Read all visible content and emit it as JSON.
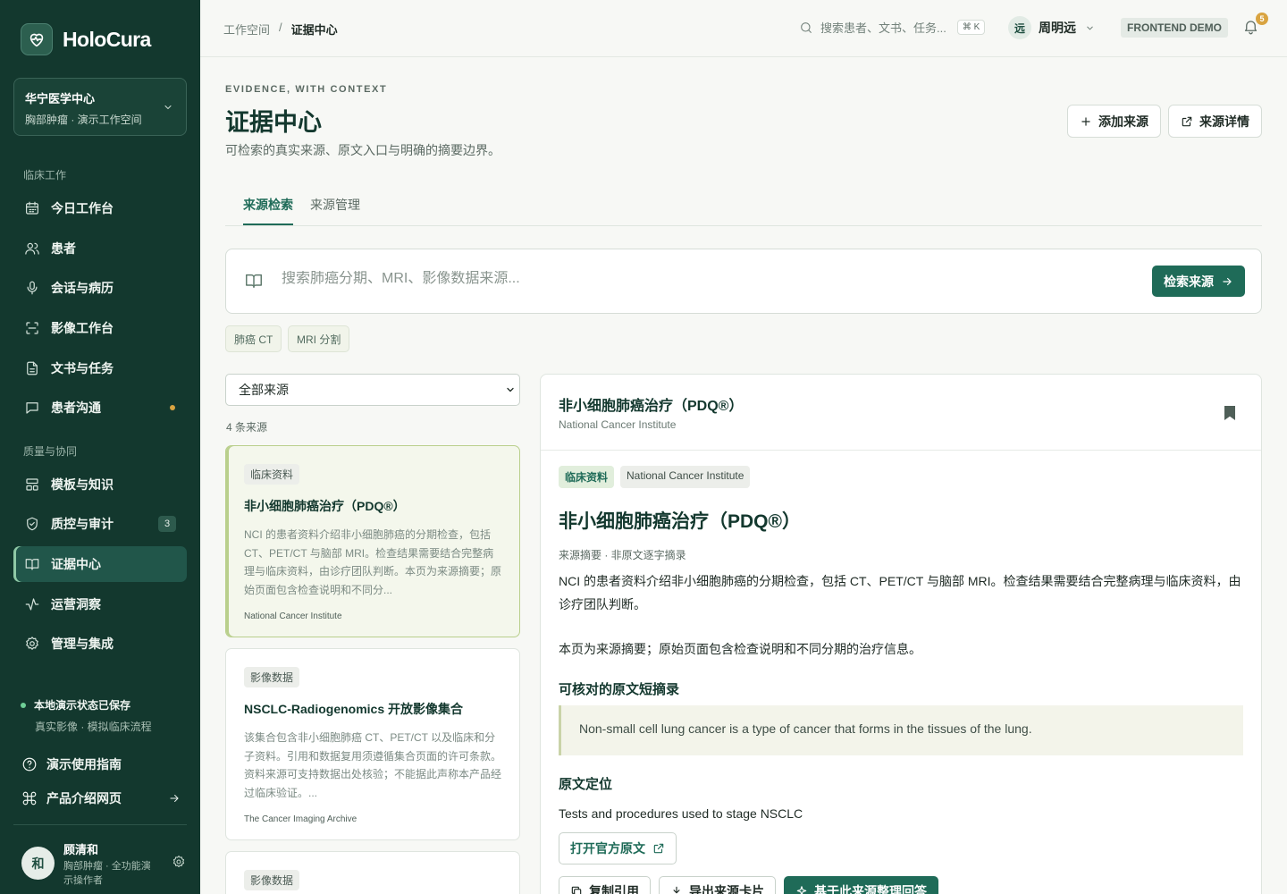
{
  "app": {
    "name": "HoloCura"
  },
  "org": {
    "name": "华宁医学中心",
    "sub": "胸部肿瘤 · 演示工作空间"
  },
  "sidebar": {
    "section1": "临床工作",
    "section2": "质量与协同",
    "items": [
      {
        "label": "今日工作台",
        "icon": "calendar-icon"
      },
      {
        "label": "患者",
        "icon": "users-icon"
      },
      {
        "label": "会话与病历",
        "icon": "microphone-icon"
      },
      {
        "label": "影像工作台",
        "icon": "scan-icon"
      },
      {
        "label": "文书与任务",
        "icon": "document-icon"
      },
      {
        "label": "患者沟通",
        "icon": "chat-icon"
      },
      {
        "label": "模板与知识",
        "icon": "layout-icon"
      },
      {
        "label": "质控与审计",
        "icon": "shield-icon",
        "badge": "3"
      },
      {
        "label": "证据中心",
        "icon": "book-icon",
        "active": true
      },
      {
        "label": "运营洞察",
        "icon": "activity-icon"
      },
      {
        "label": "管理与集成",
        "icon": "gear-icon"
      }
    ],
    "saved_title": "本地演示状态已保存",
    "saved_sub": "真实影像 · 模拟临床流程",
    "guide": "演示使用指南",
    "product": "产品介绍网页",
    "user": {
      "initial": "和",
      "name": "顾清和",
      "role": "胸部肿瘤 · 全功能演示操作者"
    }
  },
  "topbar": {
    "breadcrumb": [
      "工作空间",
      "证据中心"
    ],
    "breadcrumb_sep": "/",
    "search_placeholder": "搜索患者、文书、任务...",
    "shortcut": "⌘ K",
    "user_initial": "远",
    "user_name": "周明远",
    "demo_badge": "FRONTEND DEMO",
    "notifications": "5"
  },
  "header": {
    "eyebrow": "EVIDENCE, WITH CONTEXT",
    "title": "证据中心",
    "subtitle": "可检索的真实来源、原文入口与明确的摘要边界。",
    "add_source": "添加来源",
    "source_detail": "来源详情"
  },
  "tabs": [
    "来源检索",
    "来源管理"
  ],
  "search": {
    "placeholder": "搜索肺癌分期、MRI、影像数据来源...",
    "button": "检索来源",
    "chips": [
      "肺癌 CT",
      "MRI 分割"
    ]
  },
  "list": {
    "filter": "全部来源",
    "count": "4 条来源",
    "cards": [
      {
        "tag": "临床资料",
        "title": "非小细胞肺癌治疗（PDQ®）",
        "desc": "NCI 的患者资料介绍非小细胞肺癌的分期检查，包括 CT、PET/CT 与脑部 MRI。检查结果需要结合完整病理与临床资料，由诊疗团队判断。本页为来源摘要；原始页面包含检查说明和不同分...",
        "source": "National Cancer Institute"
      },
      {
        "tag": "影像数据",
        "title": "NSCLC-Radiogenomics 开放影像集合",
        "desc": "该集合包含非小细胞肺癌 CT、PET/CT 以及临床和分子资料。引用和数据复用须遵循集合页面的许可条款。资料来源可支持数据出处核验；不能据此声称本产品经过临床验证。...",
        "source": "The Cancer Imaging Archive"
      },
      {
        "tag": "影像数据"
      }
    ]
  },
  "detail": {
    "head_title": "非小细胞肺癌治疗（PDQ®）",
    "head_source": "National Cancer Institute",
    "tags": [
      "临床资料",
      "National Cancer Institute"
    ],
    "title": "非小细胞肺癌治疗（PDQ®）",
    "note": "来源摘要 · 非原文逐字摘录",
    "p1": "NCI 的患者资料介绍非小细胞肺癌的分期检查，包括 CT、PET/CT 与脑部 MRI。检查结果需要结合完整病理与临床资料，由诊疗团队判断。",
    "p2": "本页为来源摘要；原始页面包含检查说明和不同分期的治疗信息。",
    "excerpt_heading": "可核对的原文短摘录",
    "excerpt": "Non-small cell lung cancer is a type of cancer that forms in the tissues of the lung.",
    "locate_heading": "原文定位",
    "locate": "Tests and procedures used to stage NSCLC",
    "open_button": "打开官方原文",
    "actions": [
      "复制引用",
      "导出来源卡片",
      "基于此来源整理回答"
    ]
  },
  "colors": {
    "sidebar": "#13382e",
    "accent": "#1f6b58",
    "highlight": "#b9cf8c",
    "warning": "#d9a441"
  }
}
